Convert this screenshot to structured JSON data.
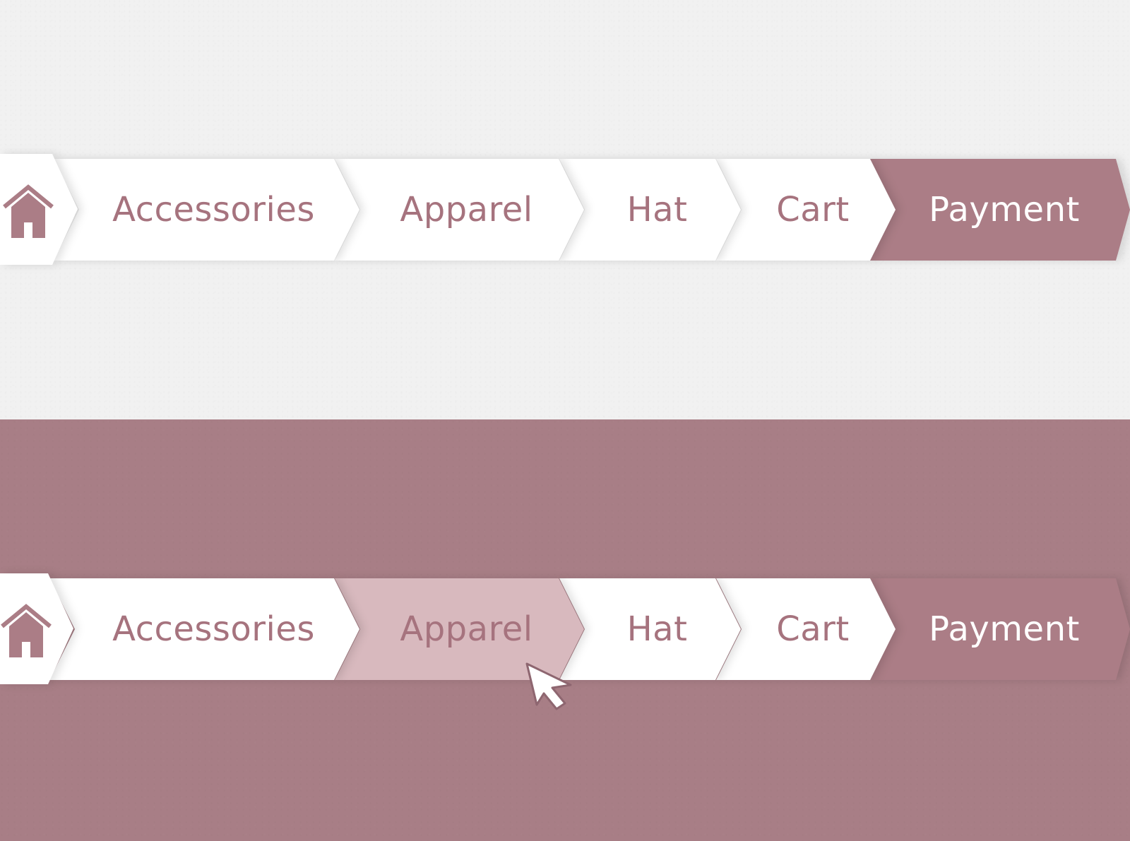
{
  "colors": {
    "accent": "#ab7d86",
    "accent_light": "#d8b9be",
    "segment_bg": "#ffffff",
    "text_default": "#a6737e",
    "text_active": "#ffffff",
    "page_light": "#f1f1f1",
    "page_dark": "#a87e86"
  },
  "breadcrumb_top": {
    "home_icon": "house-icon",
    "items": [
      {
        "label": "Accessories"
      },
      {
        "label": "Apparel"
      },
      {
        "label": "Hat"
      },
      {
        "label": "Cart"
      },
      {
        "label": "Payment",
        "active": true
      }
    ]
  },
  "breadcrumb_bottom": {
    "home_icon": "house-icon",
    "items": [
      {
        "label": "Accessories"
      },
      {
        "label": "Apparel",
        "hovered": true
      },
      {
        "label": "Hat"
      },
      {
        "label": "Cart"
      },
      {
        "label": "Payment",
        "active": true
      }
    ]
  },
  "cursor_icon": "arrow-pointer-icon"
}
